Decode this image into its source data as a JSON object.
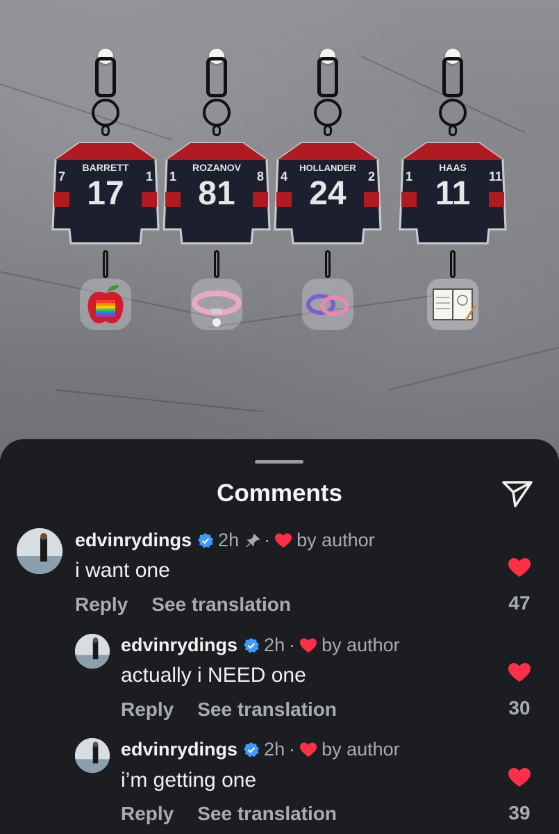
{
  "photo": {
    "keychains": [
      {
        "name": "BARRETT",
        "number": "17",
        "left_num": "7",
        "right_num": "1",
        "charm": "apple-charm"
      },
      {
        "name": "ROZANOV",
        "number": "81",
        "left_num": "1",
        "right_num": "8",
        "charm": "collar-charm"
      },
      {
        "name": "HOLLANDER",
        "number": "24",
        "left_num": "4",
        "right_num": "2",
        "charm": "rings-charm"
      },
      {
        "name": "HAAS",
        "number": "11",
        "left_num": "1",
        "right_num": "11",
        "charm": "notebook-charm"
      }
    ]
  },
  "sheet": {
    "title": "Comments",
    "send_icon": "send-icon"
  },
  "comments": [
    {
      "username": "edvinrydings",
      "time": "2h",
      "pinned": true,
      "separator": "·",
      "liked_by": "by author",
      "text": "i want one",
      "reply": "Reply",
      "see_translation": "See translation",
      "likes": "47"
    },
    {
      "username": "edvinrydings",
      "time": "2h",
      "pinned": false,
      "separator": "·",
      "liked_by": "by author",
      "text": "actually i NEED one",
      "reply": "Reply",
      "see_translation": "See translation",
      "likes": "30"
    },
    {
      "username": "edvinrydings",
      "time": "2h",
      "pinned": false,
      "separator": "·",
      "liked_by": "by author",
      "text": "i’m getting one",
      "reply": "Reply",
      "see_translation": "See translation",
      "likes": "39"
    }
  ],
  "colors": {
    "heart": "#ff2f48",
    "verified": "#3b9cff",
    "jersey_dark": "#1c1f2e",
    "jersey_red": "#b21a22"
  }
}
